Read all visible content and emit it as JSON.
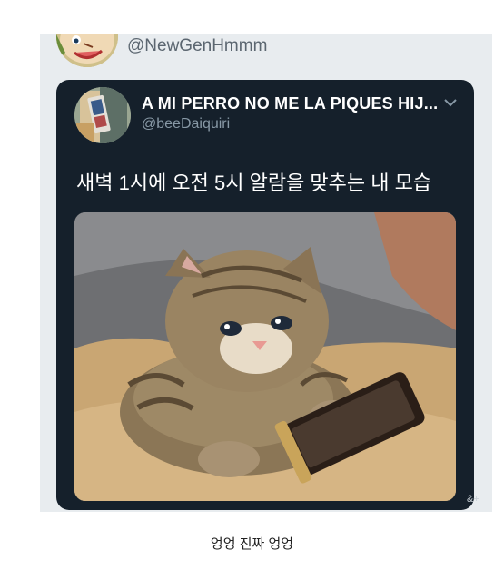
{
  "quoted_tweet": {
    "handle": "@NewGenHmmm"
  },
  "tweet": {
    "display_name": "A MI PERRO NO ME LA PIQUES HIJ...",
    "handle": "@beeDaiquiri",
    "text": "새벽 1시에 오전 5시 알람을 맞추는 내 모습"
  },
  "watermark": "&+",
  "caption": "엉엉 진짜 엉엉",
  "colors": {
    "card_bg": "#15202b",
    "outer_bg": "#e8ecef",
    "secondary_text": "#8899a6"
  },
  "icons": {
    "menu": "chevron-down-icon"
  }
}
